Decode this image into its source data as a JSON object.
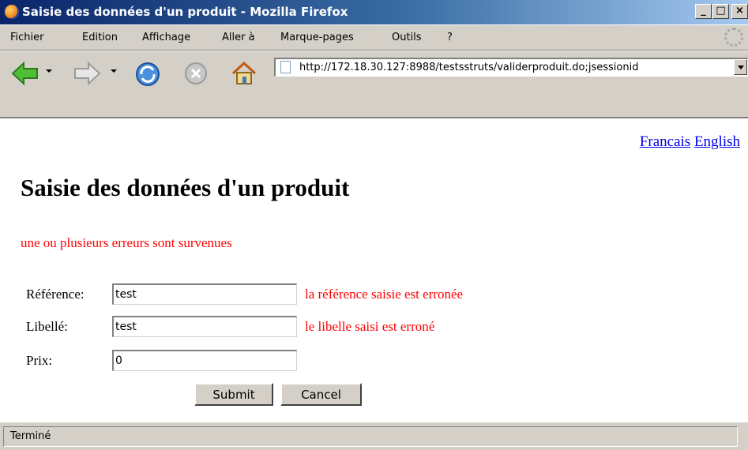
{
  "window": {
    "title": "Saisie des données d'un produit - Mozilla Firefox",
    "minimize": "_",
    "maximize": "□",
    "close": "×"
  },
  "menu": [
    "Fichier",
    "Edition",
    "Affichage",
    "Aller à",
    "Marque-pages",
    "Outils",
    "?"
  ],
  "address": {
    "url": "http://172.18.30.127:8988/testsstruts/validerproduit.do;jsessionid"
  },
  "lang_links": [
    "Francais",
    "English"
  ],
  "page": {
    "title": "Saisie des données d'un produit",
    "error_summary": "une ou plusieurs erreurs sont survenues"
  },
  "form": {
    "fields": [
      {
        "label": "Référence:",
        "value": "test",
        "error": "la référence saisie est erronée"
      },
      {
        "label": "Libellé:",
        "value": "test",
        "error": "le libelle saisi est erroné"
      },
      {
        "label": "Prix:",
        "value": "0",
        "error": ""
      }
    ],
    "submit": "Submit",
    "cancel": "Cancel"
  },
  "status": {
    "text": "Terminé"
  },
  "colors": {
    "error": "#ff0000",
    "link": "#0000ee",
    "titlebar": "#0a246a"
  },
  "icons": [
    "firefox-icon",
    "back-arrow-icon",
    "forward-arrow-icon",
    "reload-icon",
    "stop-icon",
    "home-icon",
    "page-icon",
    "throbber-icon"
  ]
}
